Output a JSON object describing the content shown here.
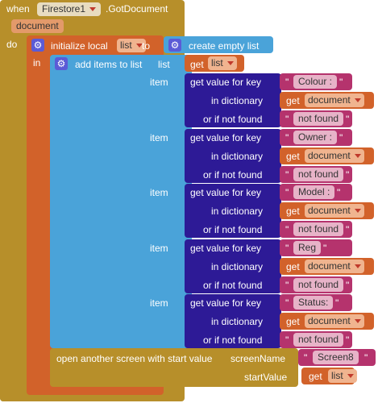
{
  "event": {
    "when": "when",
    "component": "Firestore1",
    "event_name": ".GotDocument",
    "param": "document",
    "do": "do"
  },
  "init_local": {
    "label": "initialize local",
    "var": "list",
    "to": "to",
    "in": "in",
    "create_list": "create empty list"
  },
  "add_items": {
    "label": "add items to list",
    "list_label": "list",
    "get": "get",
    "list_var": "list",
    "items": [
      {
        "item": "item",
        "gvk": "get value for key",
        "key": "Colour :",
        "in_dict": "in dictionary",
        "get": "get",
        "dict": "document",
        "not_found_label": "or if not found",
        "not_found": "not found"
      },
      {
        "item": "item",
        "gvk": "get value for key",
        "key": "Owner :",
        "in_dict": "in dictionary",
        "get": "get",
        "dict": "document",
        "not_found_label": "or if not found",
        "not_found": "not found"
      },
      {
        "item": "item",
        "gvk": "get value for key",
        "key": "Model :",
        "in_dict": "in dictionary",
        "get": "get",
        "dict": "document",
        "not_found_label": "or if not found",
        "not_found": "not found"
      },
      {
        "item": "item",
        "gvk": "get value for key",
        "key": "Reg",
        "in_dict": "in dictionary",
        "get": "get",
        "dict": "document",
        "not_found_label": "or if not found",
        "not_found": "not found"
      },
      {
        "item": "item",
        "gvk": "get value for key",
        "key": "Status:",
        "in_dict": "in dictionary",
        "get": "get",
        "dict": "document",
        "not_found_label": "or if not found",
        "not_found": "not found"
      }
    ]
  },
  "open_screen": {
    "label": "open another screen with start value",
    "screen_name_label": "screenName",
    "screen_name": "Screen8",
    "start_value_label": "startValue",
    "get": "get",
    "var": "list"
  },
  "colors": {
    "event": "#b78f2a",
    "variable": "#d2622a",
    "list": "#4aa3d9",
    "dictionary": "#2d1a96",
    "text": "#b5336d"
  }
}
